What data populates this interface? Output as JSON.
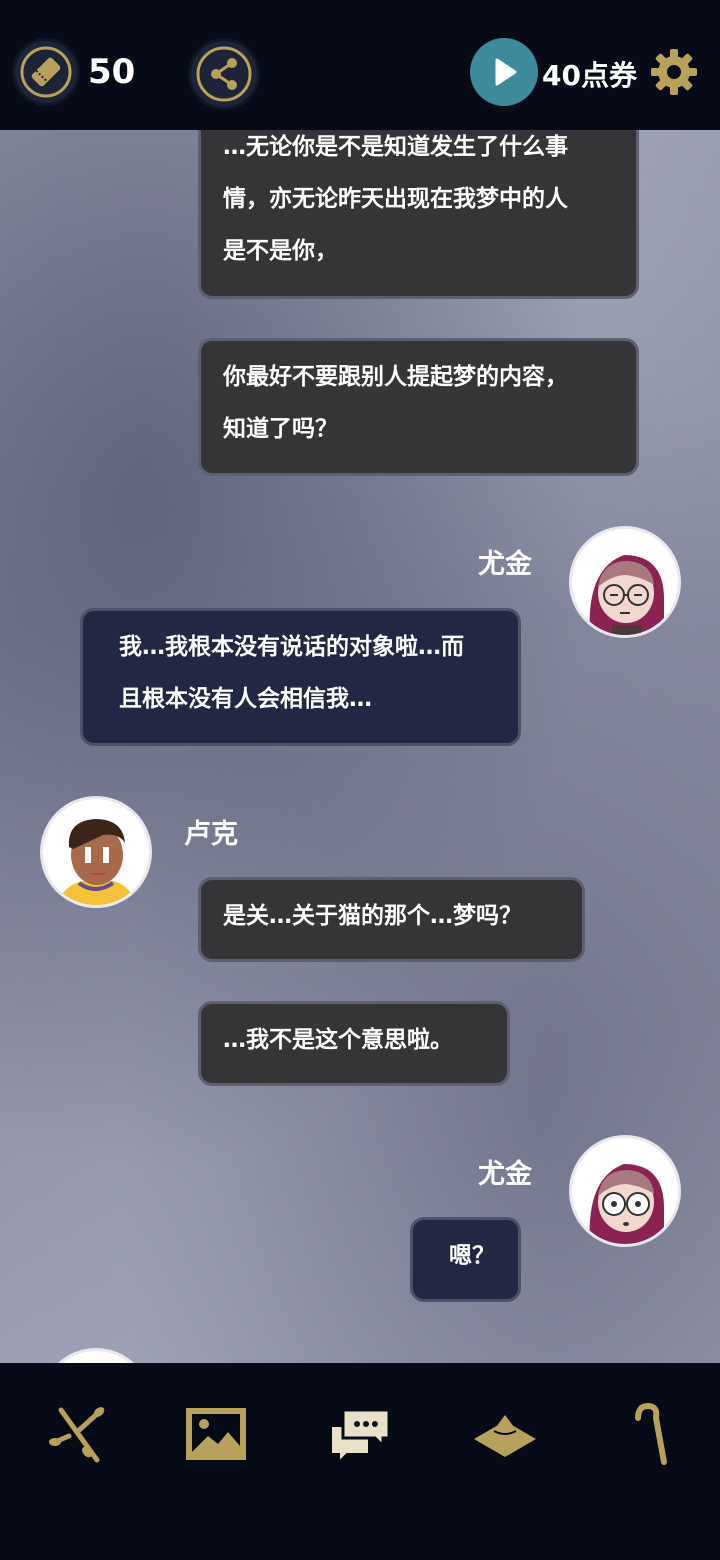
{
  "topbar": {
    "ticket_icon": "ticket-icon",
    "ticket_count": "50",
    "share_icon": "share-icon",
    "play_icon": "play-icon",
    "points_label": "40点券",
    "settings_icon": "gear-icon"
  },
  "chat": {
    "messages": [
      {
        "lines": [
          "…无论你是不是知道发生了什么事",
          "情，亦无论昨天出现在我梦中的人",
          "是不是你，"
        ]
      },
      {
        "lines": [
          "你最好不要跟别人提起梦的内容，",
          "知道了吗？"
        ]
      },
      {
        "speaker": "尤金"
      },
      {
        "lines": [
          "我…我根本没有说话的对象啦…而",
          "且根本没有人会相信我…"
        ]
      },
      {
        "speaker": "卢克"
      },
      {
        "lines": [
          "是关…关于猫的那个…梦吗？"
        ]
      },
      {
        "lines": [
          "…我不是这个意思啦。"
        ]
      },
      {
        "speaker": "尤金"
      },
      {
        "lines": [
          "嗯？"
        ]
      }
    ]
  },
  "bottombar": {
    "items": [
      {
        "icon": "branch-icon"
      },
      {
        "icon": "image-icon"
      },
      {
        "icon": "chat-icon"
      },
      {
        "icon": "hat-icon"
      },
      {
        "icon": "cane-icon"
      }
    ]
  },
  "colors": {
    "accent_gold": "#b8a15a",
    "play_teal": "#3d8a9a",
    "bubble_dark": "#353538",
    "bubble_navy": "#222843"
  }
}
